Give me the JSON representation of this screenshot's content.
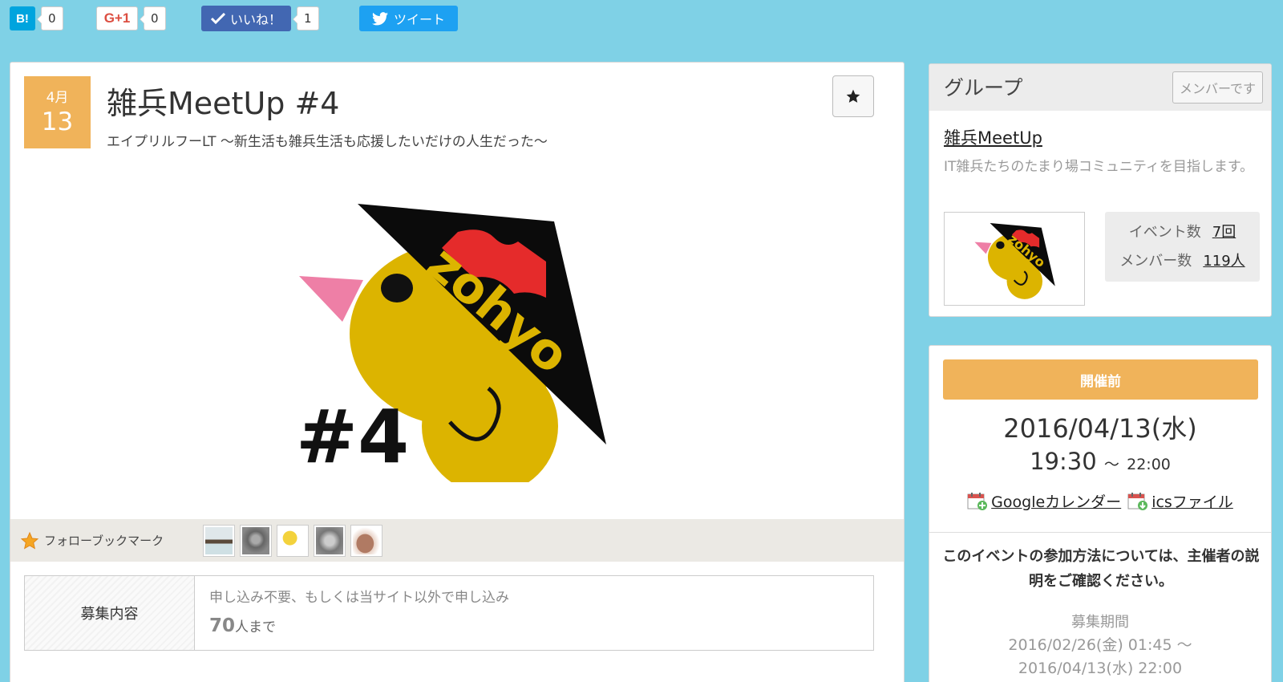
{
  "social": {
    "hatena": {
      "label": "B!",
      "count": "0"
    },
    "gplus": {
      "label": "G+1",
      "count": "0"
    },
    "facebook": {
      "label": "いいね！",
      "count": "1"
    },
    "twitter": {
      "label": "ツイート"
    }
  },
  "event": {
    "month": "4月",
    "day": "13",
    "title": "雑兵MeetUp #4",
    "subtitle": "エイプリルフーLT 〜新生活も雑兵生活も応援したいだけの人生だった〜",
    "image": {
      "brand_text": "zohyo",
      "number_text": "#4"
    }
  },
  "follow": {
    "label": "フォローブックマーク",
    "avatars": [
      "avatar-1",
      "avatar-2",
      "avatar-3",
      "avatar-4",
      "avatar-5"
    ]
  },
  "recruit": {
    "label": "募集内容",
    "note": "申し込み不要、もしくは当サイト以外で申し込み",
    "capacity_num": "70",
    "capacity_suffix": "人まで"
  },
  "group": {
    "heading": "グループ",
    "member_badge": "メンバーです",
    "name": "雑兵MeetUp",
    "description": "IT雑兵たちのたまり場コミュニティを目指します。",
    "stats": [
      {
        "label": "イベント数",
        "value": "7回"
      },
      {
        "label": "メンバー数",
        "value": "119人"
      }
    ]
  },
  "info": {
    "status": "開催前",
    "date": "2016/04/13(水)",
    "time_start": "19:30",
    "time_sep": "〜",
    "time_end": "22:00",
    "google_calendar": "Googleカレンダー",
    "ics_file": "icsファイル",
    "note": "このイベントの参加方法については、主催者の説明をご確認ください。",
    "period_label": "募集期間",
    "period_start": "2016/02/26(金) 01:45 〜",
    "period_end": "2016/04/13(水) 22:00"
  },
  "colors": {
    "background": "#7fd1e6",
    "accent_orange": "#f0b35a",
    "hatena_blue": "#00a4de",
    "facebook_blue": "#4267b2",
    "twitter_blue": "#1da1f2",
    "gplus_red": "#dc4e41"
  }
}
